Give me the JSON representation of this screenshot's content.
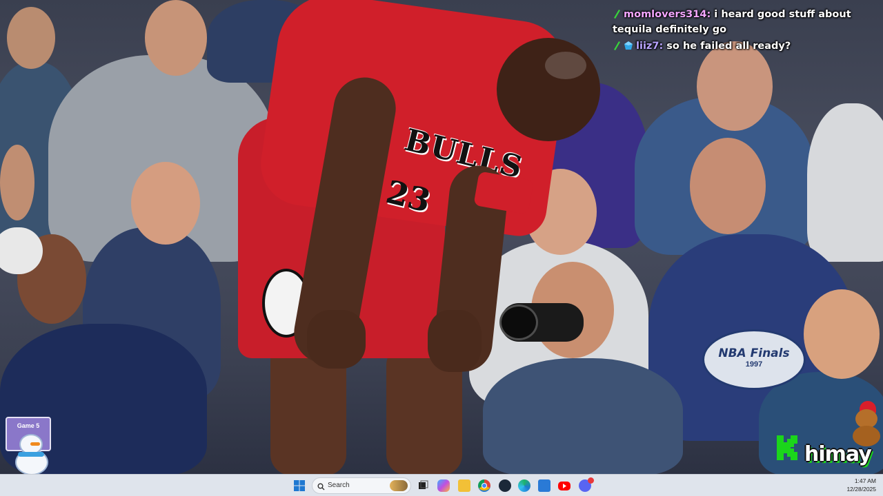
{
  "chat": {
    "messages": [
      {
        "user": "momlovers314:",
        "text": " i heard good stuff about tequila definitely go",
        "badge": "green-slash-badge"
      },
      {
        "user": "liiz7:",
        "text": " so he failed all ready?",
        "badge": "green-slash-and-gem-badge"
      }
    ]
  },
  "photo": {
    "jersey_text": "BULLS",
    "jersey_number": "23",
    "banner_text": "NBA Finals",
    "banner_year": "1997",
    "lanyard_text": "Game 5"
  },
  "logo": {
    "text": "himay",
    "icon": "kick-logo-icon"
  },
  "taskbar": {
    "search_placeholder": "Search",
    "time": "1:47 AM",
    "date": "12/28/2025",
    "icons": [
      "windows-start-icon",
      "search-icon",
      "taskview-icon",
      "copilot-icon",
      "file-explorer-icon",
      "chrome-icon",
      "steam-icon",
      "edge-icon",
      "store-icon",
      "youtube-icon",
      "discord-icon"
    ]
  },
  "colors": {
    "jersey": "#d01f2a",
    "chat_user_a": "#f3a6ff",
    "chat_user_b": "#b9a4ff",
    "kick_green": "#1bd51b",
    "taskbar": "#dfe4ec"
  }
}
